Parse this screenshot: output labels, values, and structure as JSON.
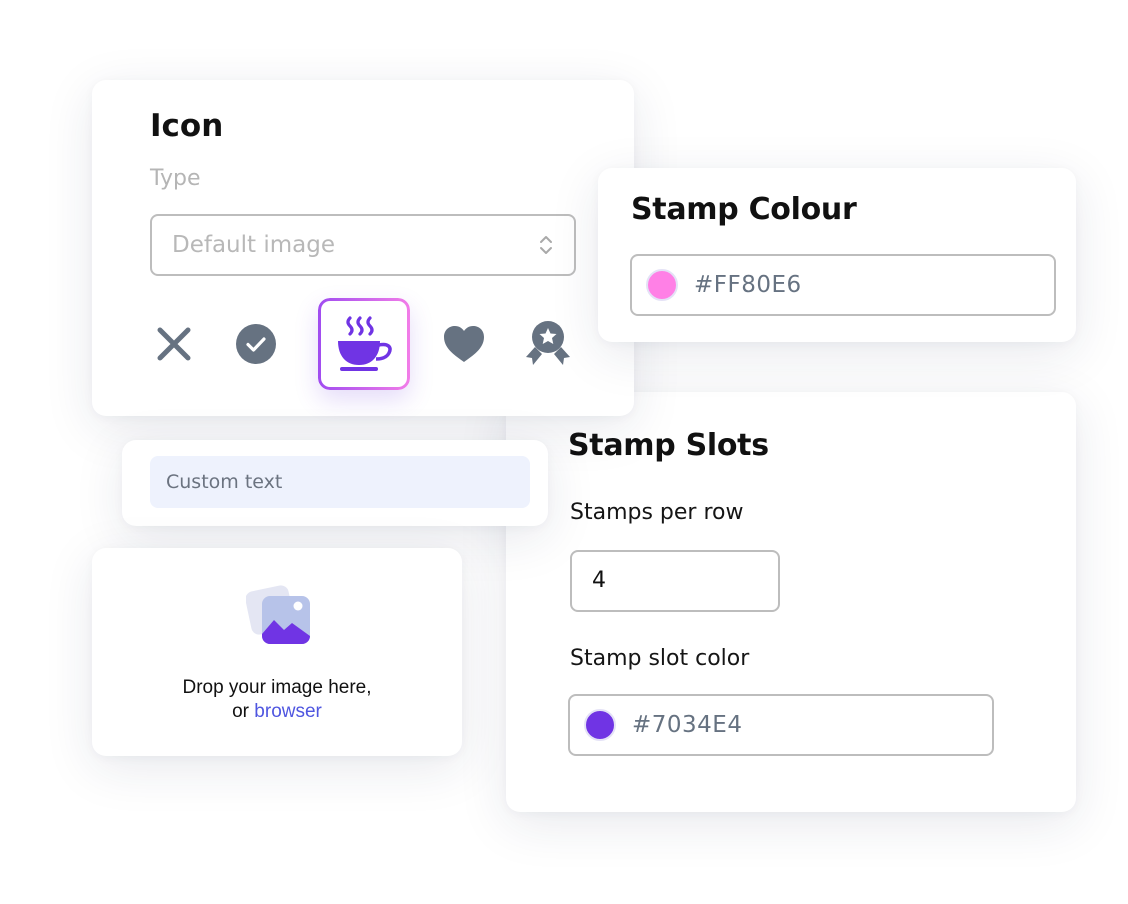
{
  "icon_panel": {
    "title": "Icon",
    "type_label": "Type",
    "type_select": {
      "value": "Default image"
    },
    "icon_options": [
      {
        "name": "x",
        "selected": false
      },
      {
        "name": "check-circle",
        "selected": false
      },
      {
        "name": "coffee-cup",
        "selected": true
      },
      {
        "name": "heart",
        "selected": false
      },
      {
        "name": "award-badge",
        "selected": false
      }
    ]
  },
  "stamp_colour": {
    "title": "Stamp Colour",
    "value": "#FF80E6",
    "swatch_color": "#FF80E6"
  },
  "custom_text": {
    "placeholder": "Custom text"
  },
  "dropzone": {
    "line1": "Drop your image here,",
    "line2_prefix": "or ",
    "link_label": "browser"
  },
  "stamp_slots": {
    "title": "Stamp Slots",
    "per_row_label": "Stamps per row",
    "per_row_value": "4",
    "slot_color_label": "Stamp slot color",
    "slot_color_value": "#7034E4",
    "slot_swatch_color": "#7034E4"
  },
  "colors": {
    "accent": "#7034E4",
    "icon_gray": "#667281",
    "link": "#4F56E0",
    "selected_border_start": "#A04CF0",
    "selected_border_end": "#F27DE8"
  }
}
